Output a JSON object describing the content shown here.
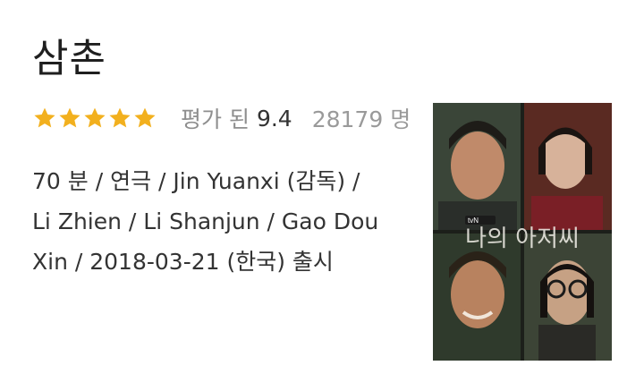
{
  "movie": {
    "title": "삼촌",
    "rating": {
      "stars": 5,
      "max_stars": 5,
      "star_color": "#f2b01e",
      "label": "평가 된",
      "value": "9.4",
      "count": "28179 명"
    },
    "details": {
      "line1": "70 분 / 연극 / Jin Yuanxi (감독) /",
      "line2": "Li Zhien / Li Shanjun / Gao Dou",
      "line3": "Xin / 2018-03-21 (한국) 출시"
    },
    "poster": {
      "overlay_title": "나의 아저씨",
      "network": "tvN"
    }
  }
}
